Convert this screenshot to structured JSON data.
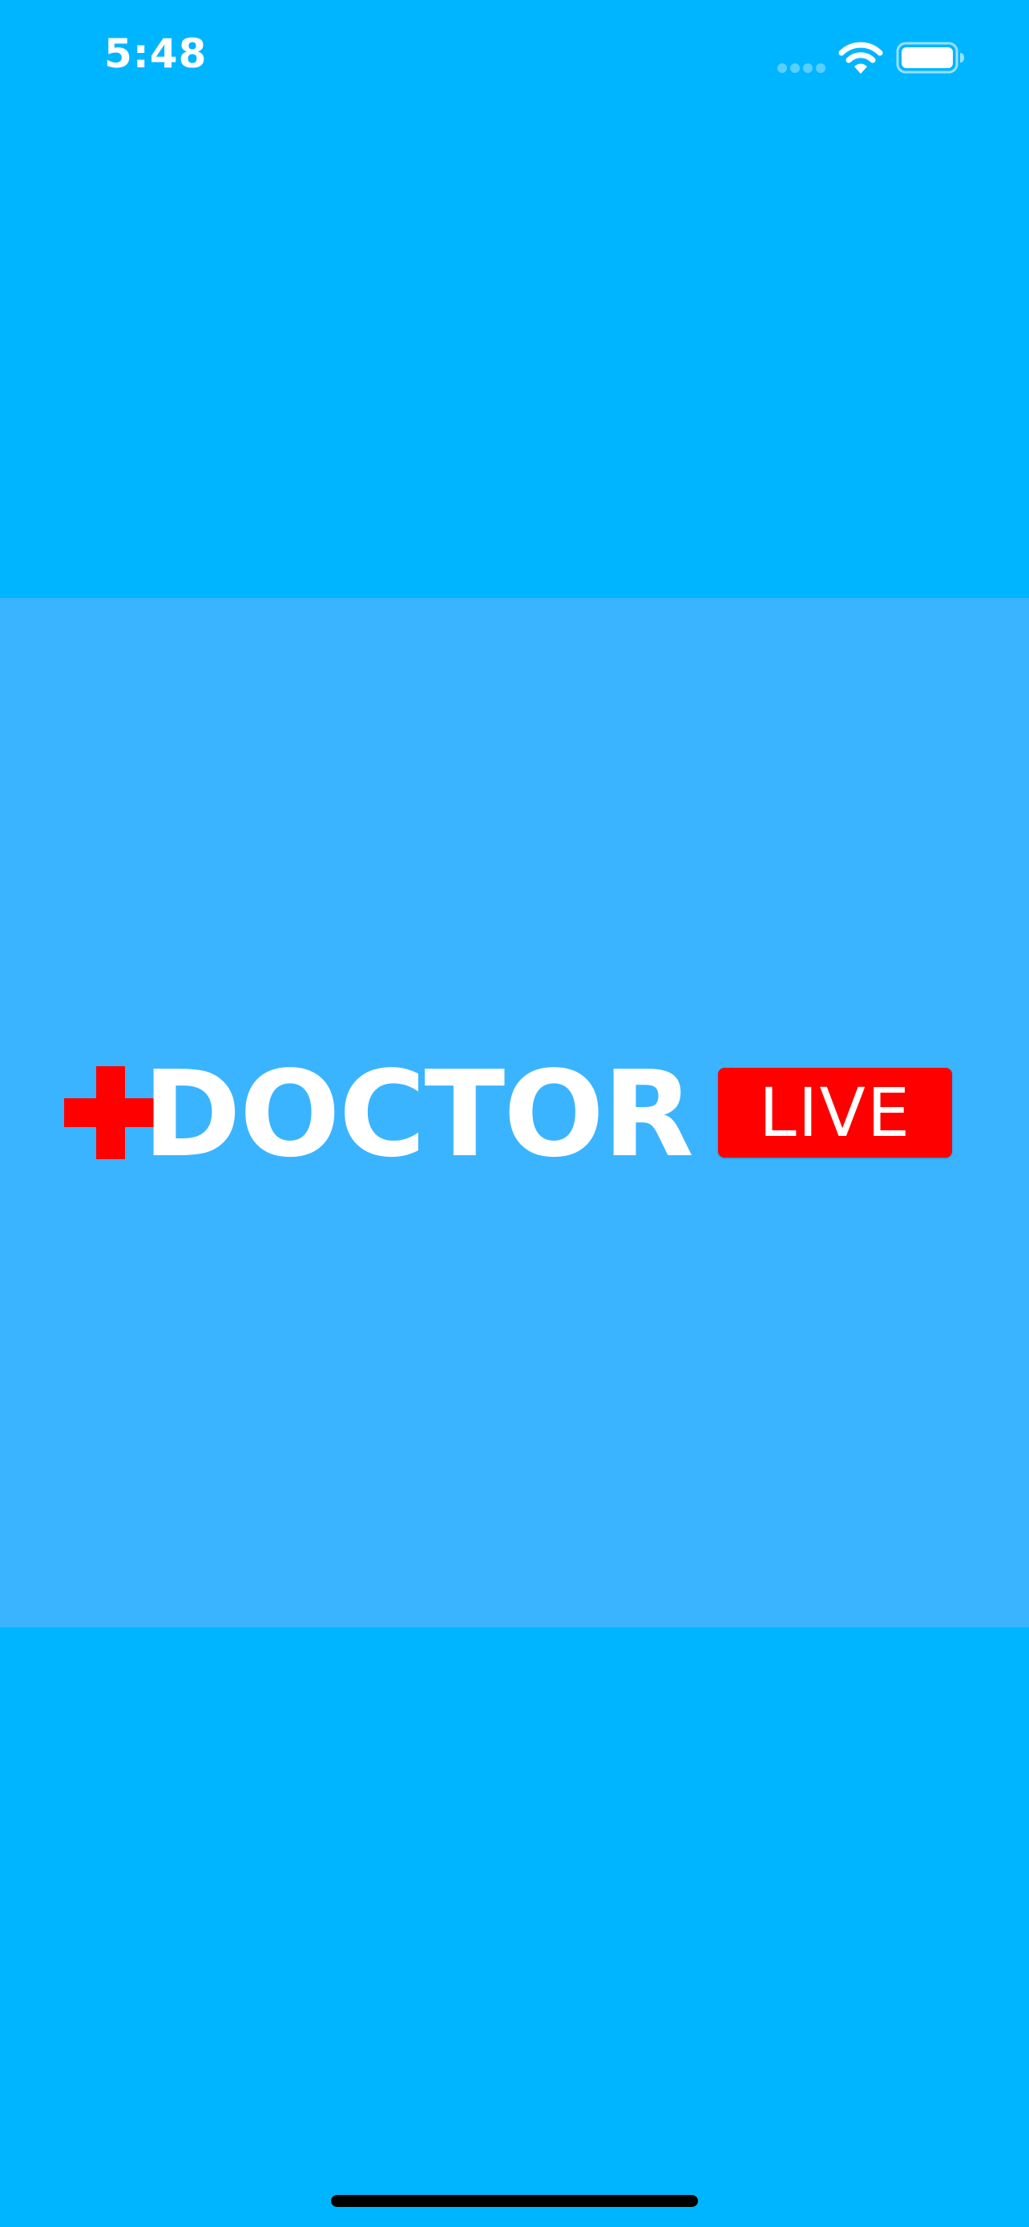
{
  "status_bar": {
    "time": "5:48",
    "signal_icon": "cellular-signal-dots",
    "wifi_icon": "wifi",
    "battery_icon": "battery-full"
  },
  "logo": {
    "cross_icon": "medical-cross",
    "word": "DOCTOR",
    "badge": "LIVE"
  },
  "colors": {
    "background": "#00b5ff",
    "splash_band": "#3ab4ff",
    "accent_red": "#ff0000",
    "text": "#ffffff"
  }
}
